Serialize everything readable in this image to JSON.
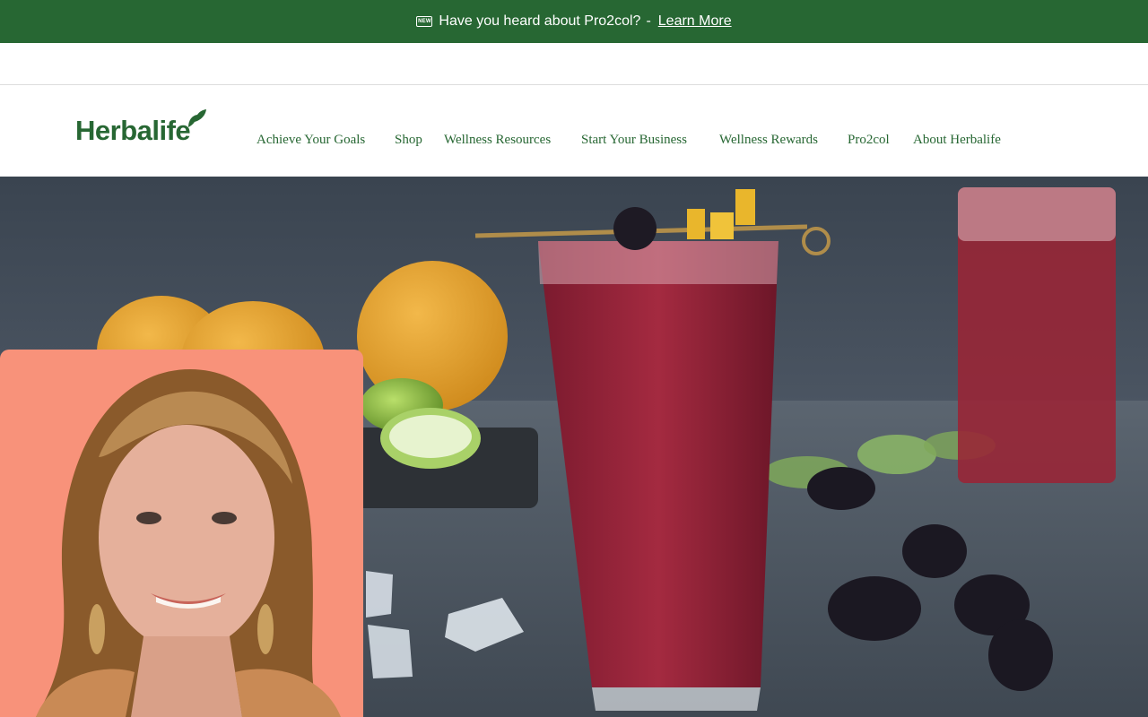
{
  "promo_banner": {
    "icon": "new-badge-icon",
    "new_badge": "NEW",
    "message": "Have you heard about Pro2col?",
    "separator": "-",
    "link": "Learn More"
  },
  "logo": {
    "text": "Herbalife",
    "icon": "leaf-icon"
  },
  "nav": {
    "items": [
      {
        "label": "Achieve Your Goals"
      },
      {
        "label": "Shop"
      },
      {
        "label": "Wellness Resources"
      },
      {
        "label": "Start Your Business"
      },
      {
        "label": "Wellness Rewards"
      },
      {
        "label": "Pro2col"
      },
      {
        "label": "About Herbalife"
      }
    ]
  },
  "colors": {
    "brand_green": "#276733",
    "portrait_bg": "#f8927a"
  }
}
